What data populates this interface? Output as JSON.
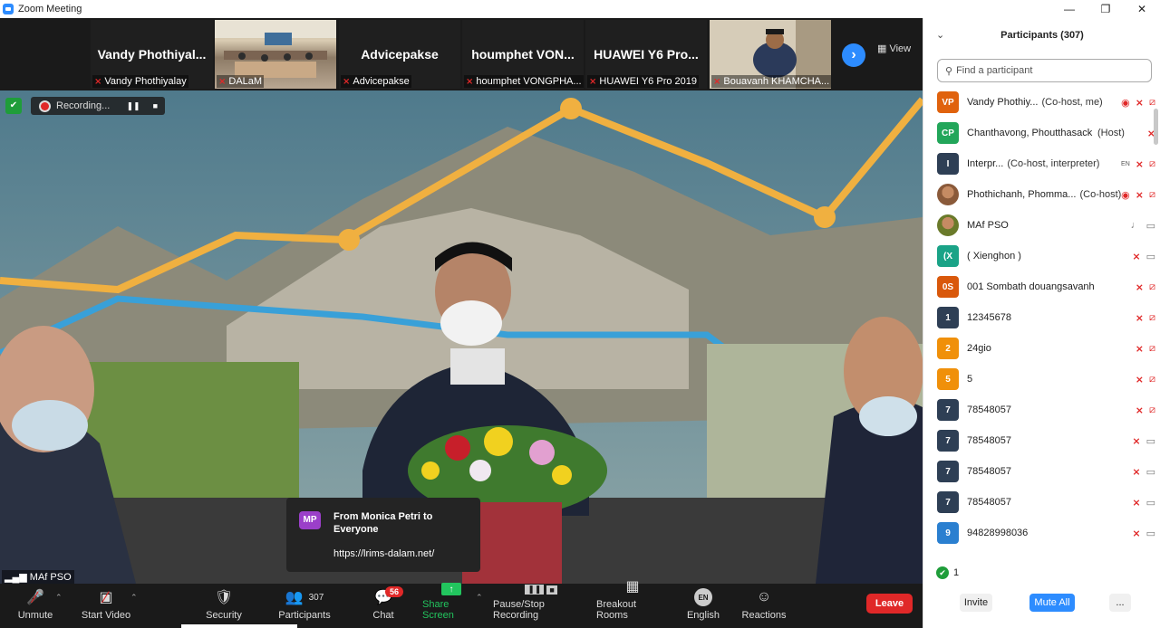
{
  "window": {
    "title": "Zoom Meeting",
    "min_icon": "minimize-icon",
    "max_icon": "restore-icon",
    "close_icon": "close-icon"
  },
  "thumbnails": [
    {
      "display_name": "Vandy  Phothiyal...",
      "label": "Vandy Phothiyalay",
      "muted": true
    },
    {
      "display_name": "",
      "label": "DALaM",
      "muted": true,
      "video": true
    },
    {
      "display_name": "Advicepakse",
      "label": "Advicepakse",
      "muted": true
    },
    {
      "display_name": "houmphet  VON...",
      "label": "houmphet VONGPHA...",
      "muted": true
    },
    {
      "display_name": "HUAWEI Y6 Pro...",
      "label": "HUAWEI Y6 Pro 2019",
      "muted": true
    },
    {
      "display_name": "",
      "label": "Bouavanh KHAMCHA...",
      "muted": true,
      "video": true
    }
  ],
  "view_label": "View",
  "recording": {
    "label": "Recording..."
  },
  "main_video": {
    "speaker_label": "MAf PSO"
  },
  "chat_popup": {
    "avatar": "MP",
    "from": "From Monica Petri to Everyone",
    "message": "https://lrims-dalam.net/"
  },
  "toolbar": {
    "unmute": "Unmute",
    "start_video": "Start Video",
    "security": "Security",
    "participants": "Participants",
    "participants_count": "307",
    "chat": "Chat",
    "chat_badge": "56",
    "share_screen": "Share Screen",
    "pause_stop_recording": "Pause/Stop Recording",
    "breakout_rooms": "Breakout Rooms",
    "english": "English",
    "english_icon_text": "EN",
    "reactions": "Reactions",
    "leave": "Leave"
  },
  "panel": {
    "title": "Participants (307)",
    "search_placeholder": "Find a participant",
    "participants": [
      {
        "initials": "VP",
        "color": "#e0620d",
        "name": "Vandy Phothiy...",
        "role": "(Co-host, me)",
        "rec": true,
        "mic": "off",
        "cam": "off"
      },
      {
        "initials": "CP",
        "color": "#22a65a",
        "name": "Chanthavong, Phoutthasack (F...",
        "role": "(Host)",
        "mic": "off",
        "cam": "none"
      },
      {
        "initials": "I",
        "color": "#2e3f55",
        "name": "Interpr...",
        "role": "(Co-host, interpreter)",
        "lang": "EN",
        "mic": "off",
        "cam": "off"
      },
      {
        "initials": "",
        "color": "#8a5a3a",
        "name": "Phothichanh, Phomma...",
        "role": "(Co-host)",
        "rec": true,
        "mic": "off",
        "cam": "off",
        "photo": true
      },
      {
        "initials": "",
        "color": "#6a7a2a",
        "name": "MAf PSO",
        "role": "",
        "mic": "on",
        "cam": "on",
        "photo": true
      },
      {
        "initials": "(X",
        "color": "#1aa387",
        "name": "( Xienghon )",
        "role": "",
        "mic": "off",
        "cam": "on"
      },
      {
        "initials": "0S",
        "color": "#d9580b",
        "name": "001 Sombath douangsavanh",
        "role": "",
        "mic": "off",
        "cam": "off"
      },
      {
        "initials": "1",
        "color": "#2e3f55",
        "name": "12345678",
        "role": "",
        "mic": "off",
        "cam": "off"
      },
      {
        "initials": "2",
        "color": "#f0900a",
        "name": "24gio",
        "role": "",
        "mic": "off",
        "cam": "off"
      },
      {
        "initials": "5",
        "color": "#f0900a",
        "name": "5",
        "role": "",
        "mic": "off",
        "cam": "off"
      },
      {
        "initials": "7",
        "color": "#2e3f55",
        "name": "78548057",
        "role": "",
        "mic": "off",
        "cam": "off"
      },
      {
        "initials": "7",
        "color": "#2e3f55",
        "name": "78548057",
        "role": "",
        "mic": "off",
        "cam": "on"
      },
      {
        "initials": "7",
        "color": "#2e3f55",
        "name": "78548057",
        "role": "",
        "mic": "off",
        "cam": "on"
      },
      {
        "initials": "7",
        "color": "#2e3f55",
        "name": "78548057",
        "role": "",
        "mic": "off",
        "cam": "on"
      },
      {
        "initials": "9",
        "color": "#2a7fd0",
        "name": "94828998036",
        "role": "",
        "mic": "off",
        "cam": "on"
      }
    ],
    "footer_count": "1",
    "invite": "Invite",
    "mute_all": "Mute All",
    "more": "..."
  }
}
